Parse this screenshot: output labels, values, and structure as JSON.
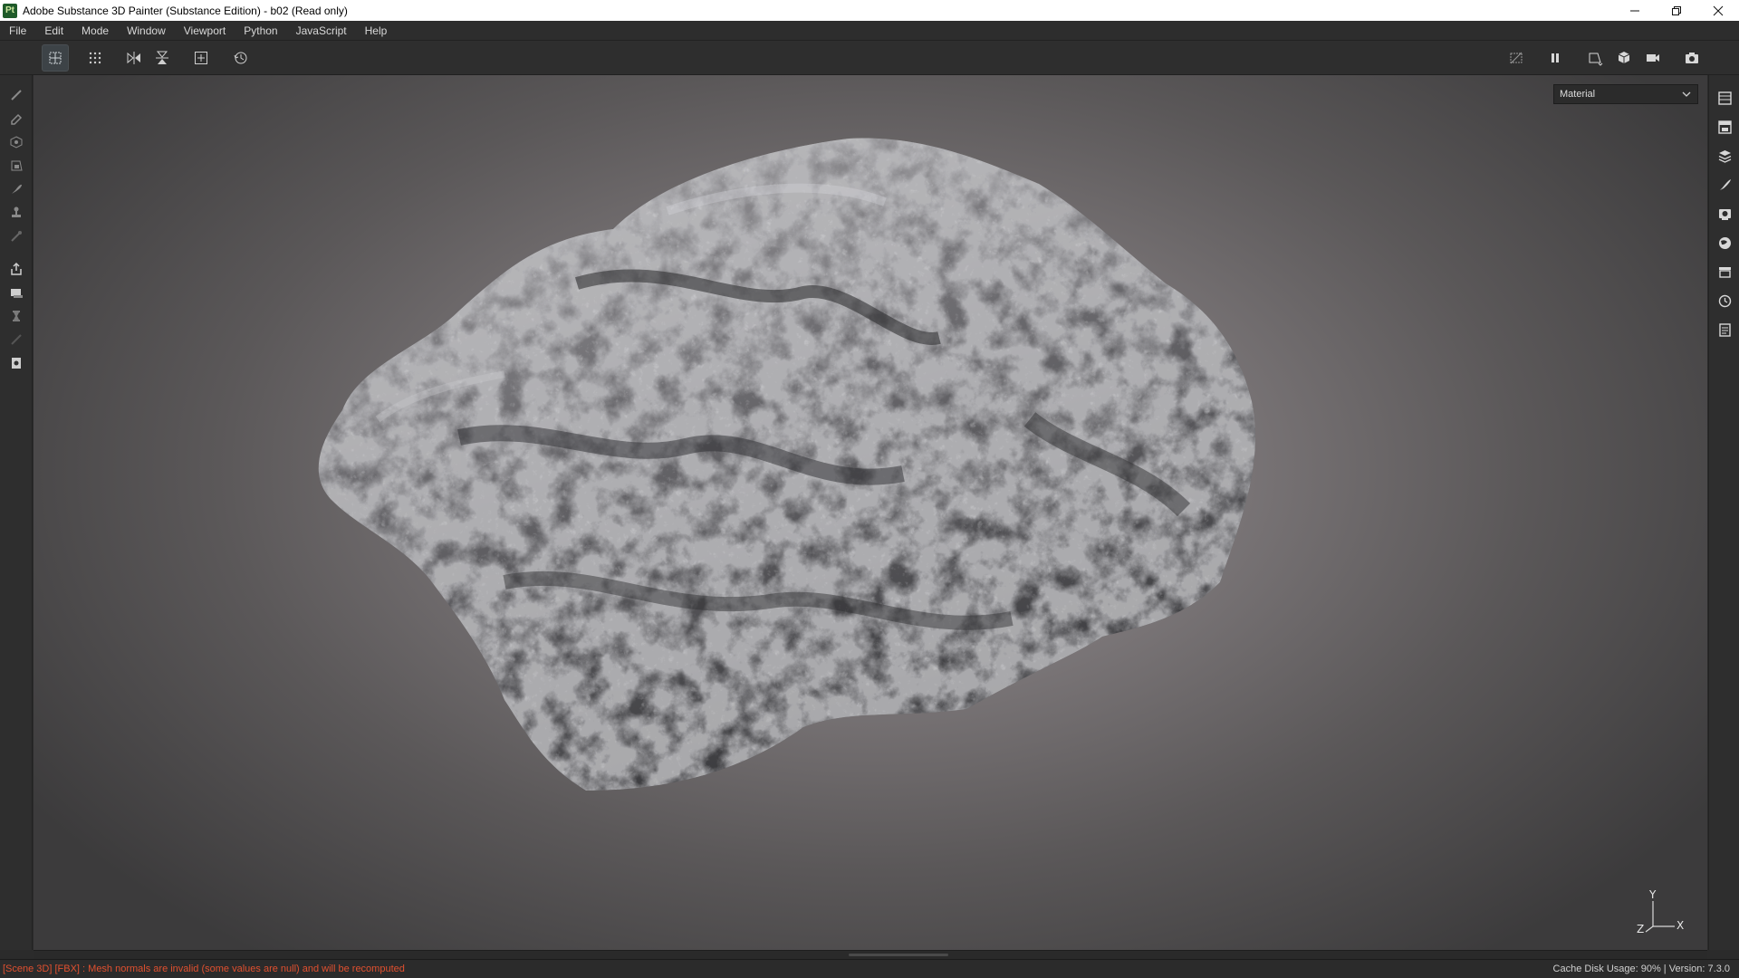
{
  "window": {
    "app_icon_text": "Pt",
    "title": "Adobe Substance 3D Painter (Substance Edition) - b02 (Read only)",
    "controls": [
      "minimize",
      "restore",
      "close"
    ]
  },
  "menu": {
    "items": [
      {
        "label": "File"
      },
      {
        "label": "Edit"
      },
      {
        "label": "Mode"
      },
      {
        "label": "Window"
      },
      {
        "label": "Viewport"
      },
      {
        "label": "Python"
      },
      {
        "label": "JavaScript"
      },
      {
        "label": "Help"
      }
    ]
  },
  "toolbar": {
    "left_icons": [
      "grid-select-icon",
      "grid-dots-icon",
      "mirror-x-icon",
      "mirror-y-icon",
      "add-frame-icon",
      "history-icon"
    ],
    "right_icons": [
      "hide-ui-icon",
      "pause-icon",
      "perspective-icon",
      "cube-view-icon",
      "camera-icon",
      "screenshot-icon"
    ]
  },
  "left_tools": [
    "paint-brush-icon",
    "eraser-icon",
    "projection-icon",
    "polygon-fill-icon",
    "smudge-icon",
    "clone-stamp-icon",
    "color-picker-icon",
    "export-icon",
    "bake-icon",
    "iray-icon",
    "geometry-icon",
    "document-icon"
  ],
  "right_tools": [
    "layers-icon",
    "texture-set-list-icon",
    "layer-stack-icon",
    "properties-icon",
    "display-settings-icon",
    "environment-icon",
    "shelf-icon",
    "history-panel-icon",
    "log-icon"
  ],
  "viewport": {
    "channel_select": "Material",
    "axes": {
      "y": "Y",
      "z": "Z",
      "x": "X"
    }
  },
  "status": {
    "message": "[Scene 3D] [FBX] : Mesh normals are invalid (some values are null) and will be recomputed",
    "right_text": "Cache Disk Usage:    90% | Version: 7.3.0"
  },
  "colors": {
    "status_error": "#e0502f",
    "panel_bg": "#2e2e2e"
  }
}
